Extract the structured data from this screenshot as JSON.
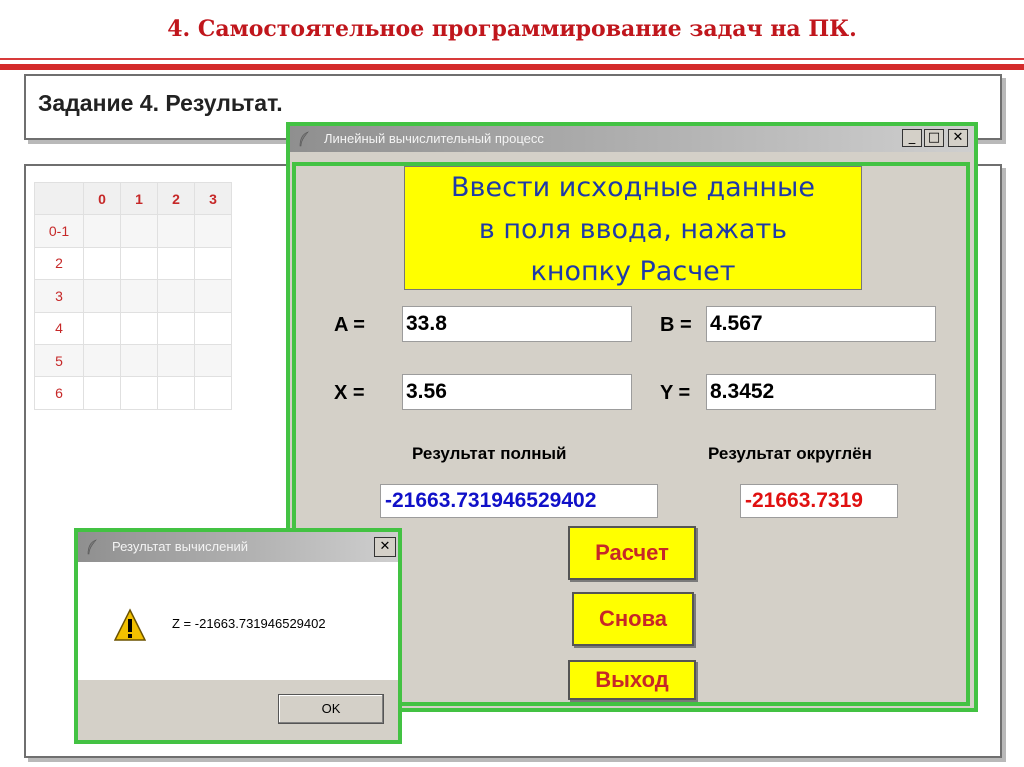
{
  "slide": {
    "title": "4. Самостоятельное программирование задач на ПК.",
    "task_heading": "Задание 4. Результат."
  },
  "grid": {
    "header": [
      "",
      "0",
      "1",
      "2",
      "3"
    ],
    "rows": [
      "0-1",
      "2",
      "3",
      "4",
      "5",
      "6"
    ]
  },
  "main_window": {
    "title": "Линейный вычислительный процесс",
    "controls": {
      "minimize": "_",
      "maximize": "□",
      "close": "✕"
    },
    "banner_lines": [
      "Ввести исходные данные",
      "в поля ввода, нажать",
      "кнопку Расчет"
    ],
    "label_a": "A =",
    "label_b": "B =",
    "label_x": "X =",
    "label_y": "Y =",
    "value_a": "33.8",
    "value_b": "4.567",
    "value_x": "3.56",
    "value_y": "8.3452",
    "label_result_full": "Результат полный",
    "label_result_rounded": "Результат округлён",
    "result_full": "-21663.731946529402",
    "result_rounded": "-21663.7319",
    "button_calc": "Расчет",
    "button_again": "Снова",
    "button_exit": "Выход"
  },
  "dialog": {
    "title": "Результат вычислений",
    "close": "✕",
    "message": "Z = -21663.731946529402",
    "ok": "OK"
  },
  "colors": {
    "accent_red": "#c0161c",
    "window_frame": "#43c243",
    "banner_bg": "#ffff00",
    "banner_text": "#1e3aa8",
    "result_full_text": "#1010c8",
    "result_rounded_text": "#e01010"
  },
  "icons": {
    "title_icon": "feather-icon",
    "dialog_icon": "warning-icon"
  }
}
